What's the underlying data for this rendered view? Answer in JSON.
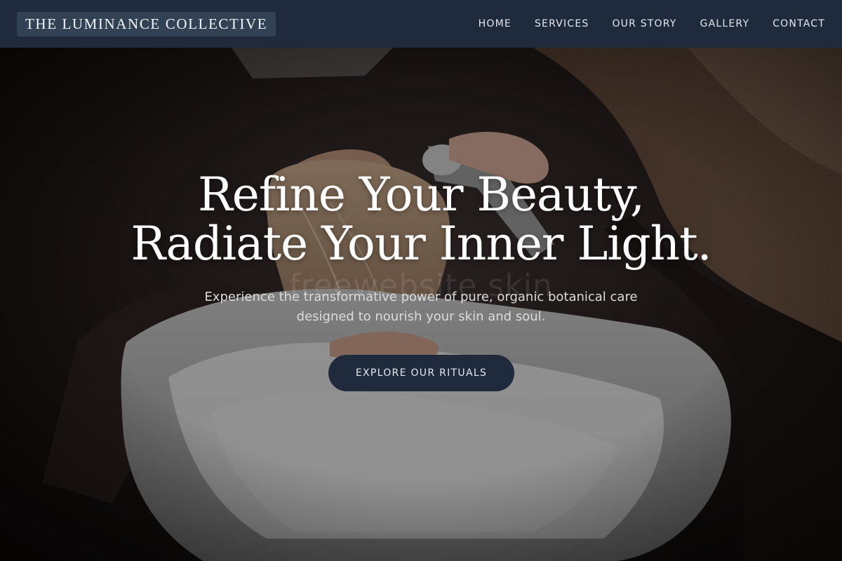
{
  "brand": {
    "name": "THE LUMINANCE COLLECTIVE"
  },
  "nav": {
    "items": [
      {
        "label": "HOME"
      },
      {
        "label": "SERVICES"
      },
      {
        "label": "OUR STORY"
      },
      {
        "label": "GALLERY"
      },
      {
        "label": "CONTACT"
      }
    ]
  },
  "hero": {
    "title_line1": "Refine Your Beauty,",
    "title_line2": "Radiate Your Inner Light.",
    "subtitle_line1": "Experience the transformative power of pure, organic botanical care",
    "subtitle_line2": "designed to nourish your skin and soul.",
    "cta_label": "EXPLORE OUR RITUALS",
    "watermark": "freewebsite skin",
    "image": "salon hair washing photo"
  },
  "colors": {
    "header_bg": "#1f2a3c",
    "logo_bg": "#334155",
    "cta_bg": "#1f2a3c",
    "text_light": "#ffffff"
  }
}
